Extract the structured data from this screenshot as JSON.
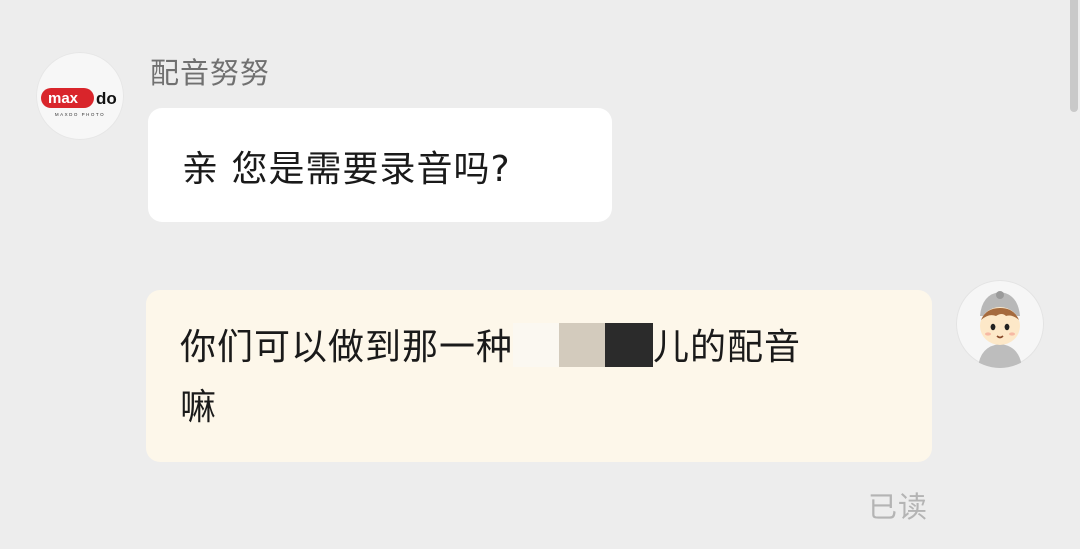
{
  "chat": {
    "incoming": {
      "sender_name": "配音努努",
      "avatar_logo_text": "maxdo",
      "avatar_logo_subtext": "MAXDO PHOTO",
      "text": "亲 您是需要录音吗?"
    },
    "outgoing": {
      "text_part1": "你们可以做到那一种",
      "text_part2": "儿的配音",
      "text_line2": "嘛",
      "avatar_icon": "cartoon-boy-icon"
    },
    "read_status": "已读"
  },
  "colors": {
    "background": "#ededed",
    "incoming_bubble": "#ffffff",
    "outgoing_bubble": "#fdf7ea",
    "logo_red": "#d9252b"
  }
}
